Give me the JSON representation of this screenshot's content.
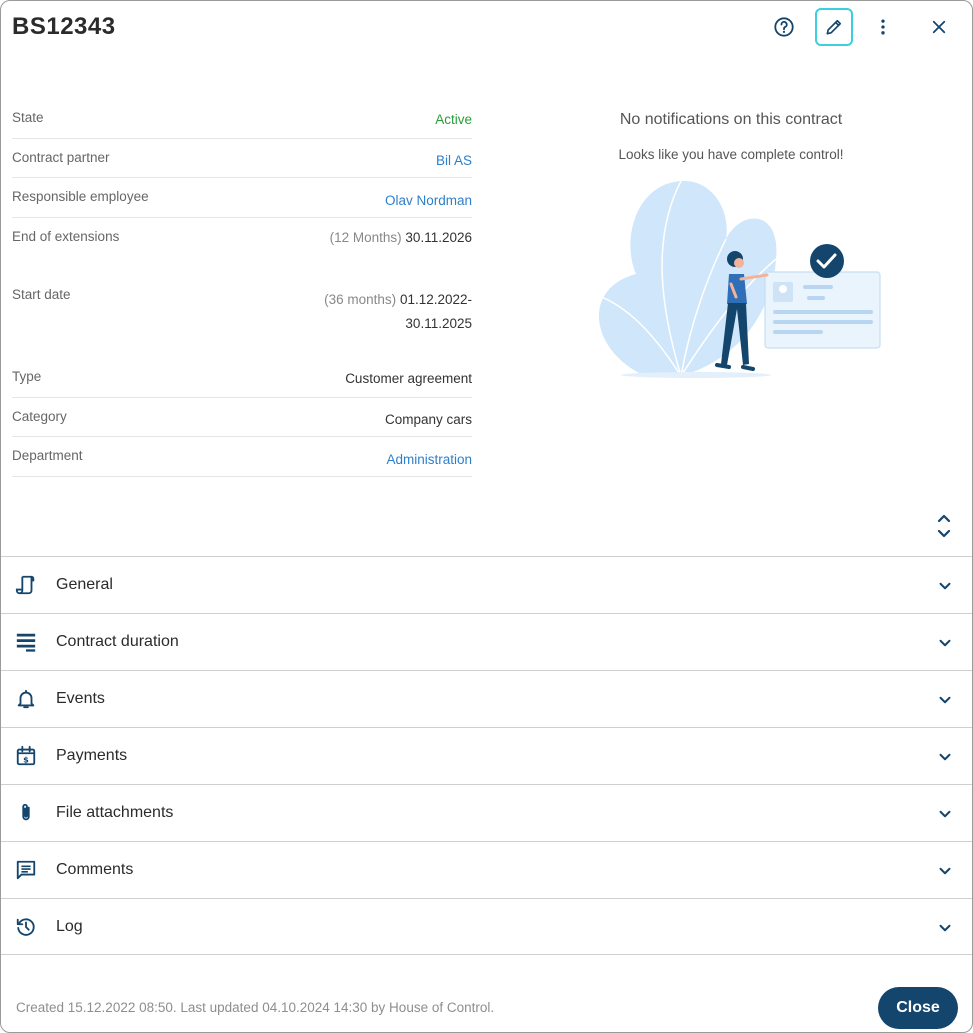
{
  "header": {
    "title": "BS12343"
  },
  "info": {
    "state": {
      "label": "State",
      "value": "Active"
    },
    "contract_partner": {
      "label": "Contract partner",
      "value": "Bil AS"
    },
    "responsible_employee": {
      "label": "Responsible employee",
      "value": "Olav Nordman"
    },
    "end_of_extensions": {
      "label": "End of extensions",
      "duration": "(12 Months)",
      "value": "30.11.2026"
    },
    "start_date": {
      "label": "Start date",
      "duration": "(36 months)",
      "value_line1": "01.12.2022-",
      "value_line2": "30.11.2025"
    },
    "type": {
      "label": "Type",
      "value": "Customer agreement"
    },
    "category": {
      "label": "Category",
      "value": "Company cars"
    },
    "department": {
      "label": "Department",
      "value": "Administration"
    }
  },
  "notifications": {
    "title": "No notifications on this contract",
    "subtitle": "Looks like you have complete control!"
  },
  "sections": [
    {
      "label": "General",
      "icon": "document-icon"
    },
    {
      "label": "Contract duration",
      "icon": "list-icon"
    },
    {
      "label": "Events",
      "icon": "bell-icon"
    },
    {
      "label": "Payments",
      "icon": "calendar-dollar-icon"
    },
    {
      "label": "File attachments",
      "icon": "paperclip-icon"
    },
    {
      "label": "Comments",
      "icon": "comment-icon"
    },
    {
      "label": "Log",
      "icon": "history-icon"
    }
  ],
  "footer": {
    "text": "Created 15.12.2022 08:50. Last updated 04.10.2024 14:30 by House of Control.",
    "close_label": "Close"
  },
  "colors": {
    "primary": "#14456d",
    "active_green": "#2a9d3a",
    "link_blue": "#2e7fc9",
    "edit_focus": "#3ccfe0"
  }
}
